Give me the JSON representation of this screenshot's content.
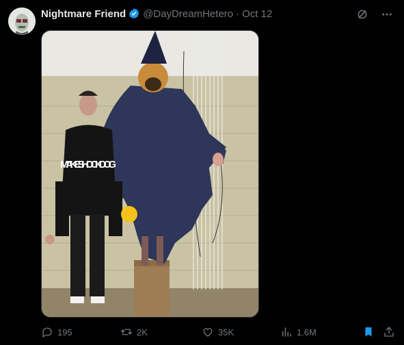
{
  "author": {
    "display_name": "Nightmare Friend",
    "handle": "@DayDreamHetero",
    "separator": "·",
    "date": "Oct 12",
    "avatar_icon": "avatar-image",
    "verified_icon": "verified-badge-icon",
    "verified_color": "#1d9bf0"
  },
  "media": {
    "shirt_text": "MAKE SHOCK DOG"
  },
  "actions": {
    "replies": "195",
    "reposts": "2K",
    "likes": "35K",
    "views": "1.6M"
  },
  "colors": {
    "background": "#000000",
    "text_primary": "#e7e9ea",
    "text_secondary": "#71767b",
    "bookmark_active": "#1d9bf0"
  }
}
